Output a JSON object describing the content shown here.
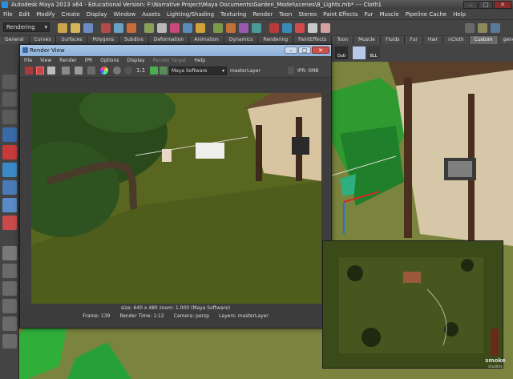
{
  "window": {
    "title": "Autodesk Maya 2013 x64 - Educational Version: F:\\Narrative Project\\Maya Documents\\Garden_Model\\scenes\\8_Lights.mb* --- Cloth1"
  },
  "menubar": [
    "File",
    "Edit",
    "Modify",
    "Create",
    "Display",
    "Window",
    "Assets",
    "Lighting/Shading",
    "Texturing",
    "Render",
    "Toon",
    "Stereo",
    "Paint Effects",
    "Fur",
    "Muscle",
    "Pipeline Cache",
    "Help"
  ],
  "statusline": {
    "mode": "Rendering"
  },
  "shelf": {
    "tabs": [
      "General",
      "Curves",
      "Surfaces",
      "Polygons",
      "Subdivs",
      "Deformation",
      "Animation",
      "Dynamics",
      "Rendering",
      "PaintEffects",
      "Toon",
      "Muscle",
      "Fluids",
      "Fur",
      "Hair",
      "nCloth",
      "Custom",
      "generBox"
    ],
    "active_tab": "Custom",
    "button_labels": [
      "Outl",
      "BLL"
    ]
  },
  "render_view": {
    "title": "Render View",
    "menu": [
      "File",
      "View",
      "Render",
      "IPR",
      "Options",
      "Display",
      "Render Target",
      "Help"
    ],
    "ratio_label": "1:1",
    "renderer": "Maya Software",
    "layer": "masterLayer",
    "ipr_label": "IPR: 0MB",
    "size_info": "size: 640 x 480  zoom: 1.000      (Maya Software)",
    "frame": "Frame: 139",
    "render_time": "Render Time: 1:12",
    "camera": "Camera: persp",
    "layers": "Layers: masterLayer"
  },
  "watermark": {
    "line1": "smoke",
    "line2": "studios"
  },
  "colors": {
    "maya_gray": "#444444",
    "titlebar_blue": "#9dbbe0",
    "grass": "#6b7a30",
    "foliage": "#2f8f2f"
  }
}
